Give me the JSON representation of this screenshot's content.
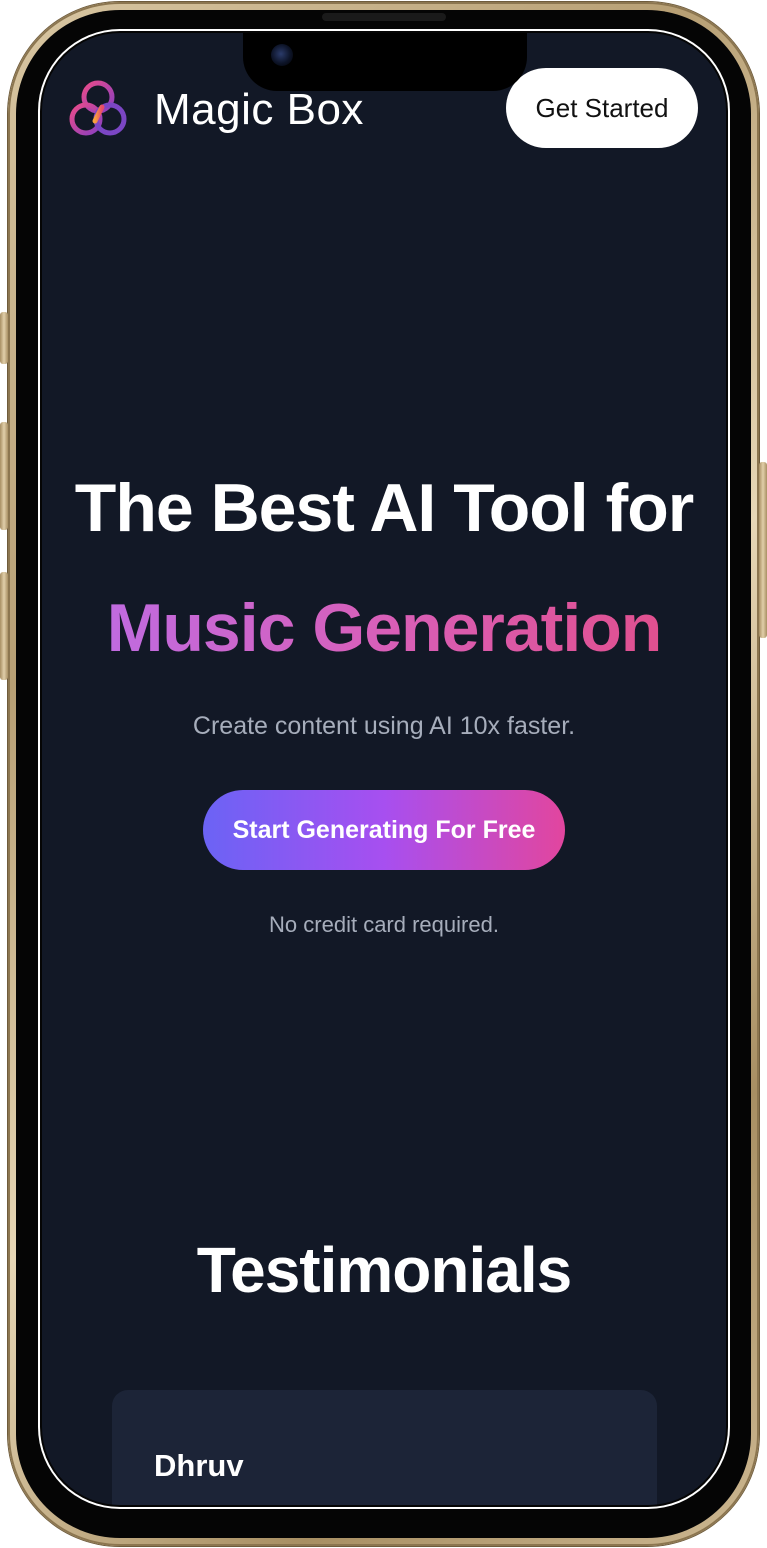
{
  "header": {
    "brand": "Magic Box",
    "cta_label": "Get Started"
  },
  "hero": {
    "title_line1": "The Best AI Tool for",
    "title_line2": "Music Generation",
    "subtitle": "Create content using AI 10x faster.",
    "cta_label": "Start Generating For Free",
    "note": "No credit card required."
  },
  "testimonials": {
    "title": "Testimonials",
    "items": [
      {
        "name": "Dhruv"
      }
    ]
  },
  "colors": {
    "background": "#121826",
    "card": "#1c2437",
    "gradient_start": "#6b63f5",
    "gradient_mid": "#a74ff0",
    "gradient_end": "#e2469e",
    "muted_text": "#a6adbb"
  },
  "icons": {
    "logo": "triple-ring-logo-icon"
  }
}
